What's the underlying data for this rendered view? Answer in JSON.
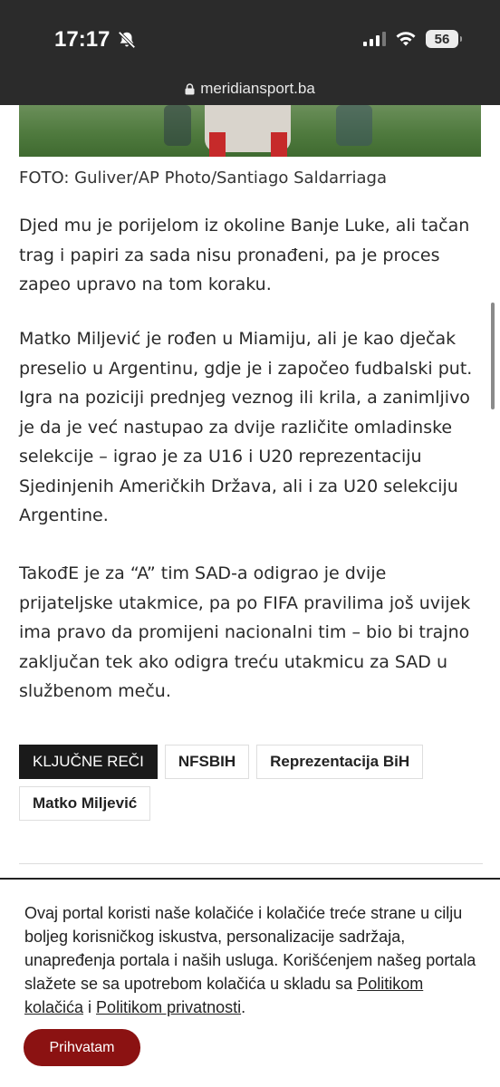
{
  "status_bar": {
    "time": "17:17",
    "battery": "56"
  },
  "browser": {
    "url": "meridiansport.ba"
  },
  "article": {
    "photo_caption": "FOTO: Guliver/AP Photo/Santiago Saldarriaga",
    "paragraphs": [
      "Djed mu je porijelom iz okoline Banje Luke, ali tačan trag i papiri za sada nisu pronađeni, pa je proces zapeo upravo na tom koraku.",
      "Matko Miljević je rođen u Miamiju, ali je kao dječak preselio u Argentinu, gdje je i započeo fudbalski put. Igra na poziciji prednjeg veznog ili krila, a zanimljivo je da je već nastupao za dvije različite omladinske selekcije – igrao je za U16 i U20 reprezentaciju Sjedinjenih Američkih Država, ali i za U20 selekciju Argentine.",
      "TakođE je za “A” tim SAD-a odigrao je dvije prijateljske utakmice, pa po FIFA pravilima još uvijek ima pravo da promijeni nacionalni tim – bio bi trajno zaključan tek ako odigra treću utakmicu za SAD u službenom meču."
    ]
  },
  "tags": {
    "heading": "KLJUČNE REČI",
    "items": [
      "NFSBIH",
      "Reprezentacija BiH",
      "Matko Miljević"
    ]
  },
  "cookie_banner": {
    "text": "Ovaj portal koristi naše kolačiće i kolačiće treće strane u cilju boljeg korisničkog iskustva, personalizacije sadržaja, unapređenja portala i naših usluga. Korišćenjem našeg portala slažete se sa upotrebom kolačića u skladu sa ",
    "link1": "Politikom kolačića",
    "separator": " i ",
    "link2": "Politikom privatnosti",
    "end": ".",
    "accept_label": "Prihvatam",
    "accent_color": "#8b1212"
  }
}
